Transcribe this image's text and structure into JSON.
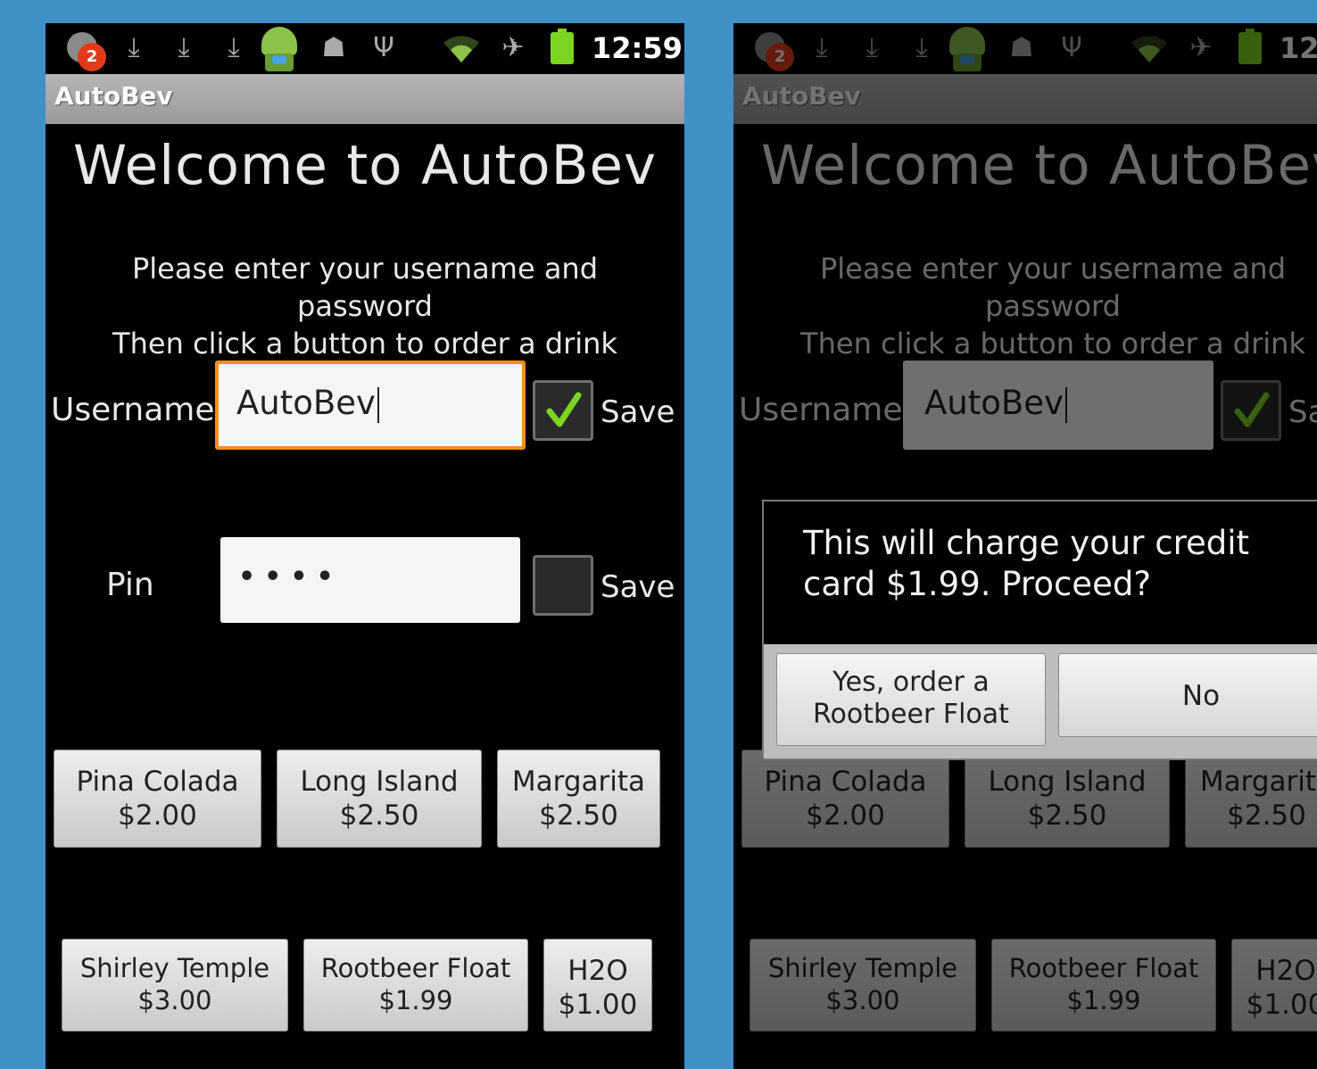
{
  "status_bar": {
    "time": "12:59",
    "notification_count": "2",
    "icons": [
      "notification-icon",
      "download-icon",
      "download-icon",
      "download-icon",
      "android-icon",
      "debug-icon",
      "usb-icon",
      "wifi-icon",
      "airplane-icon",
      "battery-icon"
    ]
  },
  "app": {
    "title": "AutoBev",
    "welcome": "Welcome to AutoBev",
    "instructions_line1": "Please enter your username and password",
    "instructions_line2": "Then click a button to order a drink"
  },
  "form": {
    "username_label": "Username",
    "username_value": "AutoBev",
    "username_save_label": "Save",
    "username_save_checked": true,
    "pin_label": "Pin",
    "pin_value": "••••",
    "pin_save_label": "Save",
    "pin_save_checked": false
  },
  "drinks": [
    {
      "name": "Pina Colada",
      "price": "$2.00"
    },
    {
      "name": "Long Island",
      "price": "$2.50"
    },
    {
      "name": "Margarita",
      "price": "$2.50"
    },
    {
      "name": "Shirley Temple",
      "price": "$3.00"
    },
    {
      "name": "Rootbeer Float",
      "price": "$1.99"
    },
    {
      "name": "H2O",
      "price": "$1.00"
    }
  ],
  "dialog": {
    "message": "This will charge your credit card $1.99.  Proceed?",
    "yes_label": "Yes, order a Rootbeer Float",
    "no_label": "No"
  },
  "colors": {
    "background": "#3e90c6",
    "focus_border": "#f0911a",
    "check_green": "#7cd421",
    "badge_red": "#e23b1c"
  }
}
